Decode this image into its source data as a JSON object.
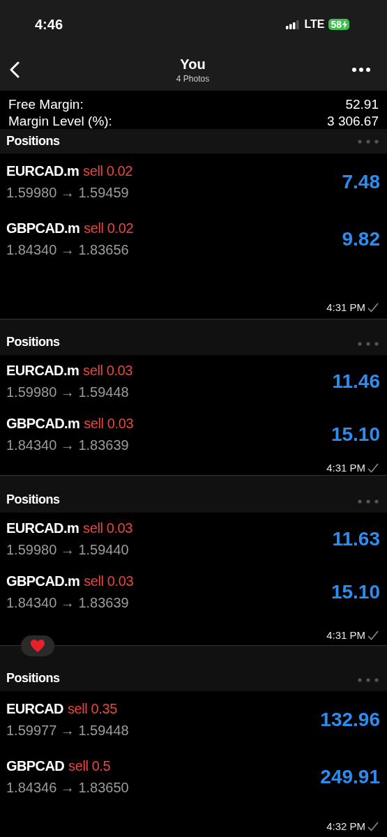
{
  "status_bar": {
    "time": "4:46",
    "network": "LTE",
    "battery": "58",
    "charging": true
  },
  "header": {
    "title": "You",
    "subtitle": "4 Photos"
  },
  "photos": [
    {
      "account": [
        {
          "label": "Free Margin:",
          "value": "52.91"
        },
        {
          "label": "Margin Level (%):",
          "value": "3 306.67"
        }
      ],
      "title": "Positions",
      "positions": [
        {
          "symbol": "EURCAD.m",
          "side": "sell 0.02",
          "prices": "1.59980 → 1.59459",
          "profit": "7.48"
        },
        {
          "symbol": "GBPCAD.m",
          "side": "sell 0.02",
          "prices": "1.84340 → 1.83656",
          "profit": "9.82"
        }
      ],
      "time": "4:31 PM"
    },
    {
      "title": "Positions",
      "positions": [
        {
          "symbol": "EURCAD.m",
          "side": "sell 0.03",
          "prices": "1.59980 → 1.59448",
          "profit": "11.46"
        },
        {
          "symbol": "GBPCAD.m",
          "side": "sell 0.03",
          "prices": "1.84340 → 1.83639",
          "profit": "15.10"
        }
      ],
      "time": "4:31 PM"
    },
    {
      "title": "Positions",
      "positions": [
        {
          "symbol": "EURCAD.m",
          "side": "sell 0.03",
          "prices": "1.59980 → 1.59440",
          "profit": "11.63"
        },
        {
          "symbol": "GBPCAD.m",
          "side": "sell 0.03",
          "prices": "1.84340 → 1.83639",
          "profit": "15.10"
        }
      ],
      "time": "4:31 PM",
      "reaction": {
        "kind": "heart"
      }
    },
    {
      "title": "Positions",
      "positions": [
        {
          "symbol": "EURCAD",
          "side": "sell 0.35",
          "prices": "1.59977 → 1.59448",
          "profit": "132.96"
        },
        {
          "symbol": "GBPCAD",
          "side": "sell 0.5",
          "prices": "1.84346 → 1.83650",
          "profit": "249.91"
        }
      ],
      "time": "4:32 PM"
    }
  ]
}
